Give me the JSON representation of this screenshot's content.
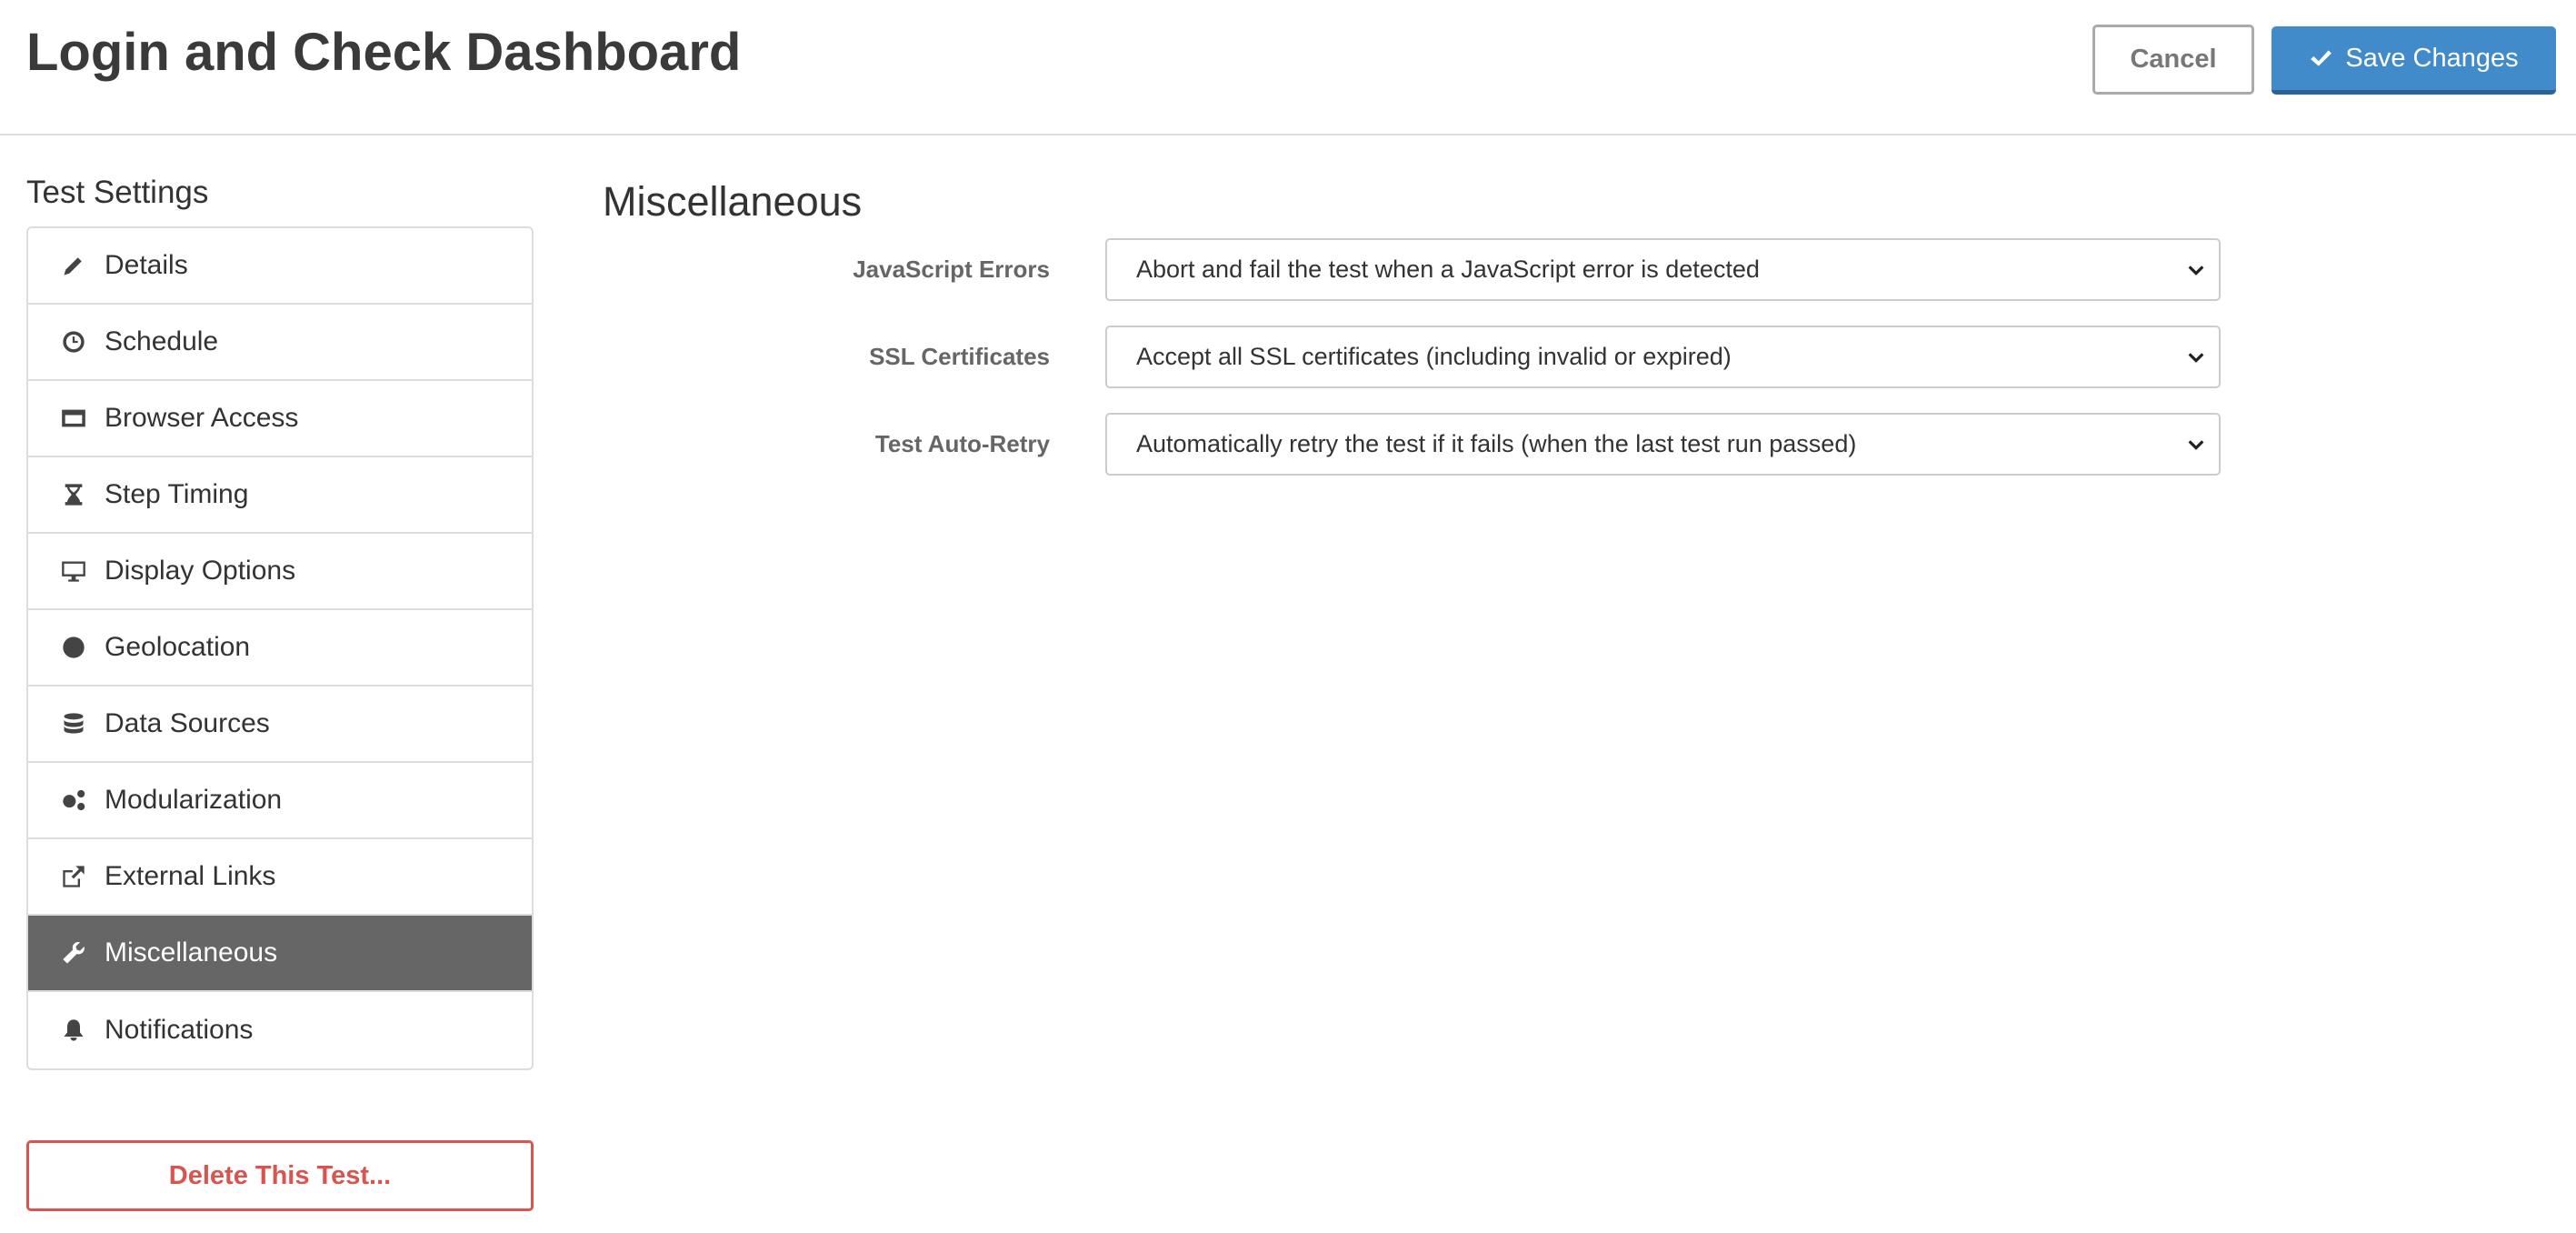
{
  "header": {
    "title": "Login and Check Dashboard",
    "cancel_label": "Cancel",
    "save_label": "Save Changes"
  },
  "sidebar": {
    "title": "Test Settings",
    "items": [
      {
        "label": "Details",
        "icon": "pencil-icon"
      },
      {
        "label": "Schedule",
        "icon": "clock-icon"
      },
      {
        "label": "Browser Access",
        "icon": "browser-window-icon"
      },
      {
        "label": "Step Timing",
        "icon": "hourglass-icon"
      },
      {
        "label": "Display Options",
        "icon": "monitor-icon"
      },
      {
        "label": "Geolocation",
        "icon": "globe-icon"
      },
      {
        "label": "Data Sources",
        "icon": "database-icon"
      },
      {
        "label": "Modularization",
        "icon": "gears-icon"
      },
      {
        "label": "External Links",
        "icon": "external-link-icon"
      },
      {
        "label": "Miscellaneous",
        "icon": "wrench-icon",
        "active": true
      },
      {
        "label": "Notifications",
        "icon": "bell-icon"
      }
    ],
    "delete_label": "Delete This Test..."
  },
  "main": {
    "title": "Miscellaneous",
    "fields": [
      {
        "label": "JavaScript Errors",
        "value": "Abort and fail the test when a JavaScript error is detected"
      },
      {
        "label": "SSL Certificates",
        "value": "Accept all SSL certificates (including invalid or expired)"
      },
      {
        "label": "Test Auto-Retry",
        "value": "Automatically retry the test if it fails (when the last test run passed)"
      }
    ]
  },
  "colors": {
    "primary": "#428bca",
    "danger": "#d9534f",
    "active_item": "#666666"
  }
}
